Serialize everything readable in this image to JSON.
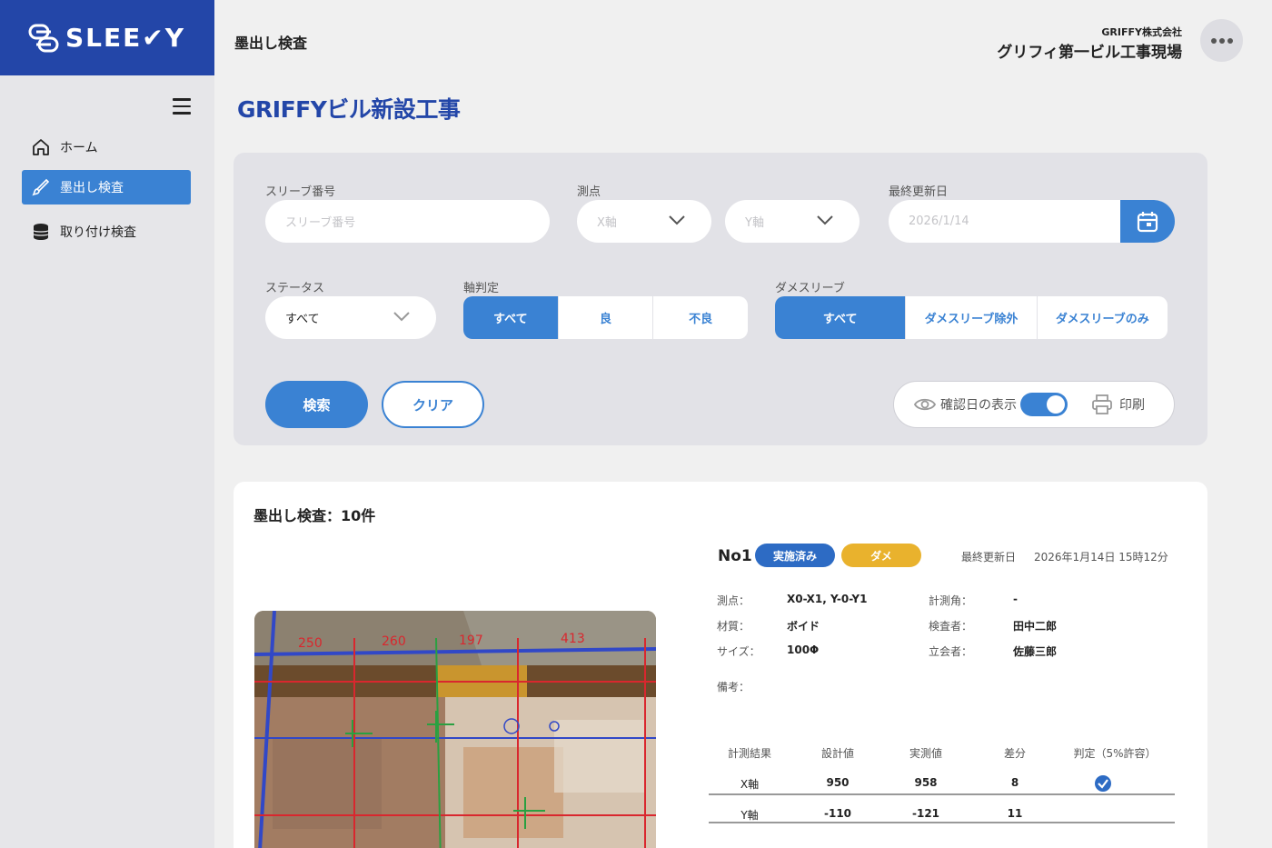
{
  "app": {
    "logo_text": "SLEE✔Y"
  },
  "sidebar": {
    "items": [
      {
        "label": "ホーム",
        "icon": "home-icon"
      },
      {
        "label": "墨出し検査",
        "icon": "brush-icon"
      },
      {
        "label": "取り付け検査",
        "icon": "database-icon"
      }
    ]
  },
  "header": {
    "crumb": "墨出し検査",
    "company": "GRIFFY株式会社",
    "site": "グリフィ第一ビル工事現場",
    "project_title": "GRIFFYビル新設工事"
  },
  "search": {
    "sleeve_label": "スリーブ番号",
    "sleeve_placeholder": "スリーブ番号",
    "point_label": "測点",
    "x_axis": "X軸",
    "y_axis": "Y軸",
    "updated_label": "最終更新日",
    "updated_value": "2026/1/14",
    "status_label": "ステータス",
    "status_value": "すべて",
    "axis_judge_label": "軸判定",
    "axis_judge_options": [
      "すべて",
      "良",
      "不良"
    ],
    "dame_label": "ダメスリーブ",
    "dame_options": [
      "すべて",
      "ダメスリーブ除外",
      "ダメスリーブのみ"
    ],
    "search_button": "検索",
    "clear_button": "クリア",
    "show_confirm_label": "確認日の表示",
    "print_label": "印刷"
  },
  "results": {
    "title": "墨出し検査：10件",
    "record": {
      "no": "No1",
      "badge_done": "実施済み",
      "badge_dame": "ダメ",
      "updated_label": "最終更新日",
      "updated_value": "2026年1月14日 15時12分",
      "point_k": "測点：",
      "point_v": "X0-X1, Y-0-Y1",
      "angle_k": "計測角：",
      "angle_v": "-",
      "material_k": "材質：",
      "material_v": "ボイド",
      "inspector_k": "検査者：",
      "inspector_v": "田中二郎",
      "size_k": "サイズ：",
      "size_v": "100Φ",
      "witness_k": "立会者：",
      "witness_v": "佐藤三郎",
      "note_k": "備考："
    },
    "table": {
      "headers": [
        "計測結果",
        "設計値",
        "実測値",
        "差分",
        "判定（5%許容）"
      ],
      "rows": [
        {
          "axis": "X軸",
          "design": "950",
          "actual": "958",
          "diff": "8",
          "ok": true
        },
        {
          "axis": "Y軸",
          "design": "-110",
          "actual": "-121",
          "diff": "11",
          "ok": false
        }
      ]
    },
    "photo_marks": [
      "250",
      "260",
      "197",
      "413"
    ]
  },
  "colors": {
    "brand": "#2346a8",
    "accent": "#3a82d3",
    "warn": "#e9b22d"
  }
}
